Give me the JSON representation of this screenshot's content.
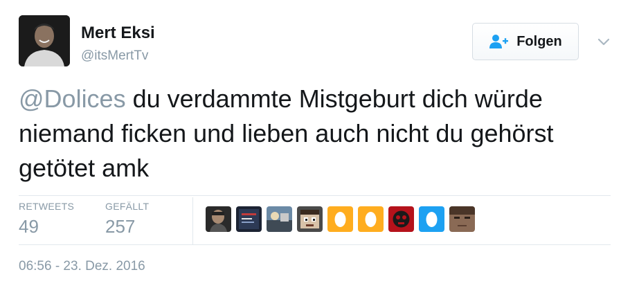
{
  "user": {
    "name": "Mert Eksi",
    "handle": "@itsMertTv"
  },
  "follow_button": {
    "label": "Folgen"
  },
  "tweet": {
    "mention": "@Dolices",
    "text": " du verdammte Mistgeburt dich würde niemand ficken und lieben auch nicht du gehörst getötet amk"
  },
  "stats": {
    "retweets_label": "RETWEETS",
    "retweets_value": "49",
    "likes_label": "GEFÄLLT",
    "likes_value": "257"
  },
  "liker_avatars": [
    {
      "icon": "person-photo-icon",
      "bg": "#2a2a2a"
    },
    {
      "icon": "dark-poster-icon",
      "bg": "#1c2333"
    },
    {
      "icon": "scene-thumbnail-icon",
      "bg": "#6b8aa6"
    },
    {
      "icon": "pixel-face-icon",
      "bg": "#4a4a4a"
    },
    {
      "icon": "default-egg-icon",
      "bg": "#ffad1f"
    },
    {
      "icon": "default-egg-icon",
      "bg": "#ffad1f"
    },
    {
      "icon": "red-skull-icon",
      "bg": "#b5121b"
    },
    {
      "icon": "default-egg-icon",
      "bg": "#1da1f2"
    },
    {
      "icon": "face-closeup-icon",
      "bg": "#8a6a55"
    }
  ],
  "timestamp": "06:56 - 23. Dez. 2016",
  "colors": {
    "text": "#14171a",
    "muted": "#8899a6",
    "accent": "#1da1f2",
    "divider": "#e1e8ed"
  }
}
